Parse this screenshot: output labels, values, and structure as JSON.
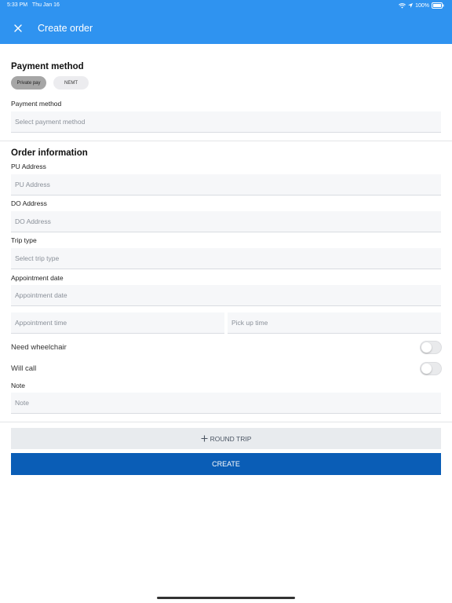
{
  "status": {
    "time": "5:33 PM",
    "date": "Thu Jan 16",
    "battery": "100%"
  },
  "header": {
    "title": "Create order",
    "close_icon": "close-icon",
    "background": "#2f93f0"
  },
  "payment": {
    "section_title": "Payment method",
    "chips": {
      "private_pay": "Private pay",
      "nemt": "NEMT"
    },
    "method_label": "Payment method",
    "method_placeholder": "Select payment method"
  },
  "order": {
    "section_title": "Order information",
    "pu_label": "PU Address",
    "pu_placeholder": "PU Address",
    "do_label": "DO Address",
    "do_placeholder": "DO Address",
    "trip_label": "Trip type",
    "trip_placeholder": "Select trip type",
    "appt_label": "Appointment date",
    "appt_date_placeholder": "Appointment date",
    "appt_time_placeholder": "Appointment time",
    "pickup_time_placeholder": "Pick up time",
    "wheelchair_label": "Need wheelchair",
    "willcall_label": "Will call",
    "note_label": "Note",
    "note_placeholder": "Note"
  },
  "buttons": {
    "round_trip": "ROUND TRIP",
    "create": "CREATE",
    "create_color": "#0a5db6"
  }
}
